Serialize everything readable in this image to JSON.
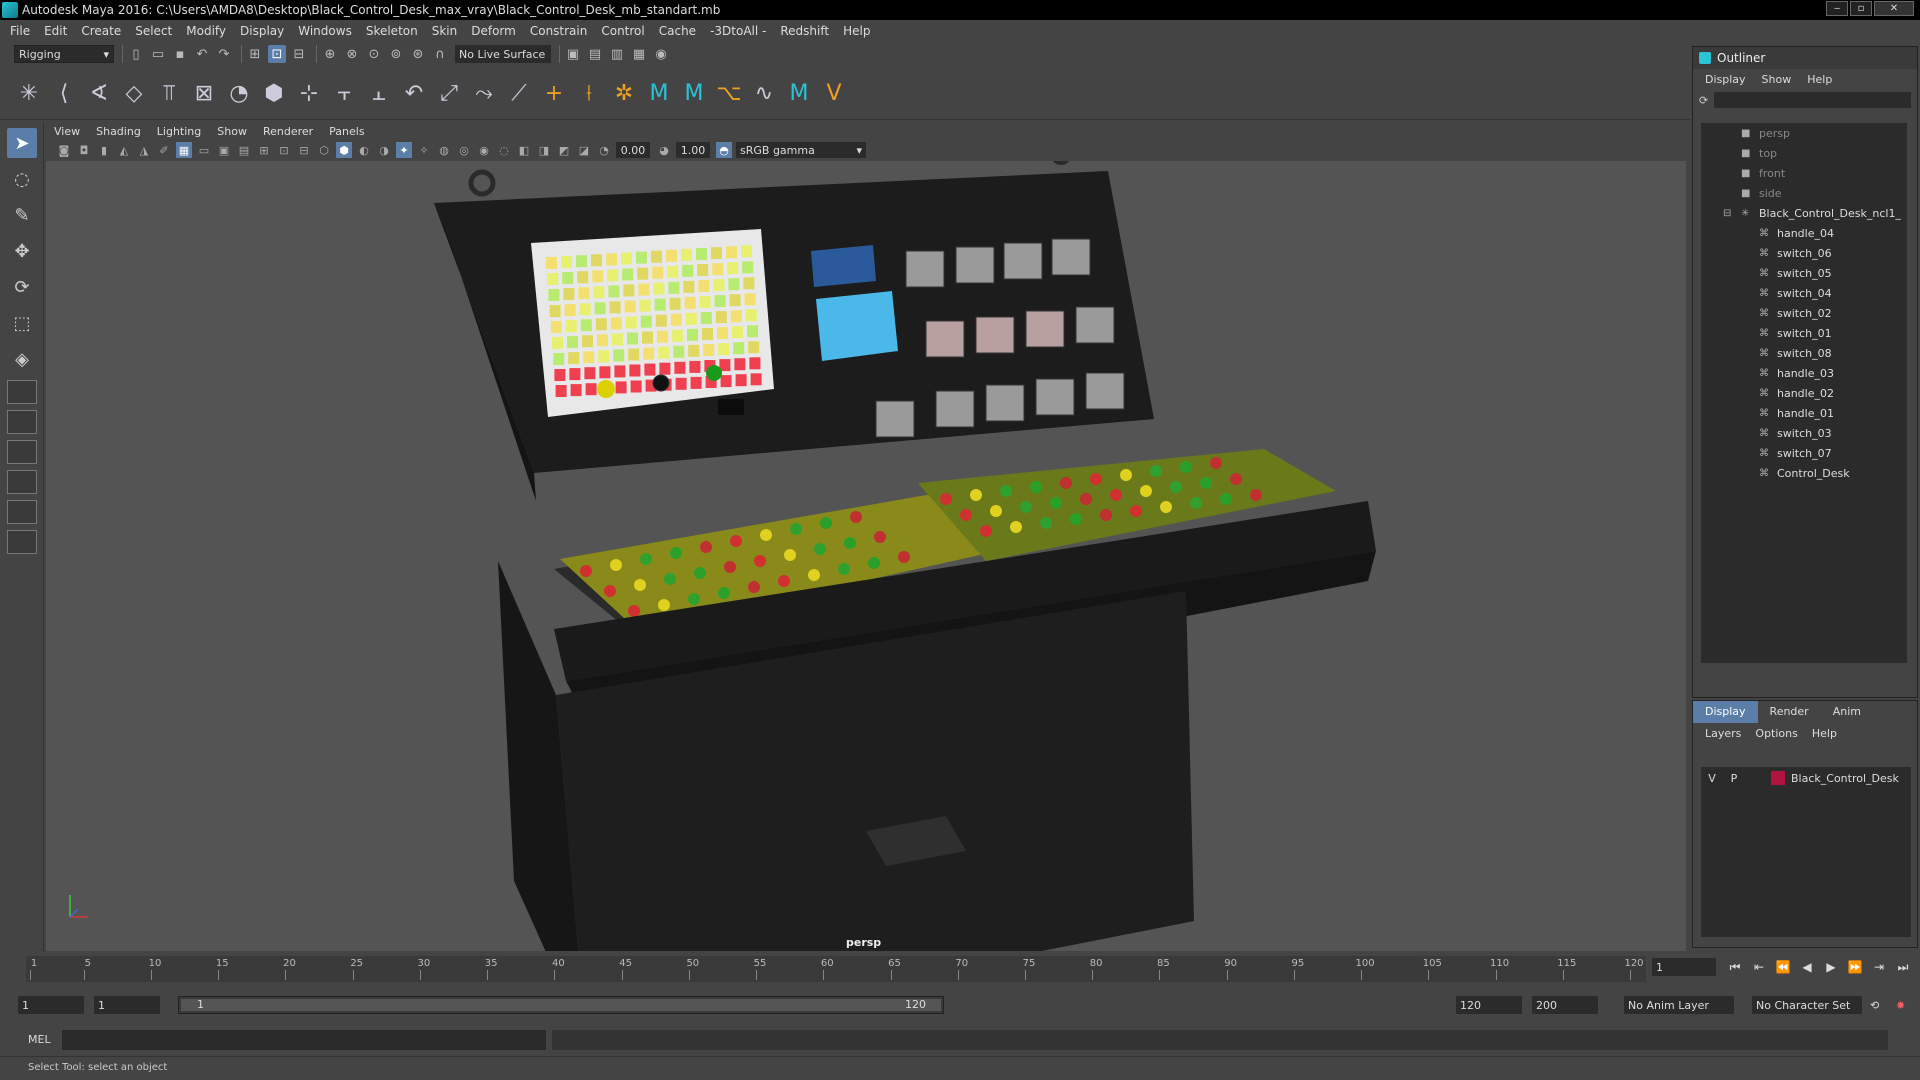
{
  "window": {
    "title": "Autodesk Maya 2016: C:\\Users\\AMDA8\\Desktop\\Black_Control_Desk_max_vray\\Black_Control_Desk_mb_standart.mb"
  },
  "menubar": [
    "File",
    "Edit",
    "Create",
    "Select",
    "Modify",
    "Display",
    "Windows",
    "Skeleton",
    "Skin",
    "Deform",
    "Constrain",
    "Control",
    "Cache",
    "-3DtoAll -",
    "Redshift",
    "Help"
  ],
  "toolbar": {
    "mode": "Rigging",
    "live_surface": "No Live Surface"
  },
  "viewport": {
    "menu": [
      "View",
      "Shading",
      "Lighting",
      "Show",
      "Renderer",
      "Panels"
    ],
    "exposure": "0.00",
    "gamma_value": "1.00",
    "color_space": "sRGB gamma",
    "camera_label": "persp"
  },
  "outliner": {
    "title": "Outliner",
    "menu": [
      "Display",
      "Show",
      "Help"
    ],
    "cameras": [
      "persp",
      "top",
      "front",
      "side"
    ],
    "root": "Black_Control_Desk_ncl1_",
    "children": [
      "handle_04",
      "switch_06",
      "switch_05",
      "switch_04",
      "switch_02",
      "switch_01",
      "switch_08",
      "handle_03",
      "handle_02",
      "handle_01",
      "switch_03",
      "switch_07",
      "Control_Desk"
    ]
  },
  "layers": {
    "tabs": [
      "Display",
      "Render",
      "Anim"
    ],
    "menu": [
      "Layers",
      "Options",
      "Help"
    ],
    "row": {
      "v": "V",
      "p": "P",
      "name": "Black_Control_Desk",
      "color": "#b01540"
    }
  },
  "timeline": {
    "ticks": [
      1,
      5,
      10,
      15,
      20,
      25,
      30,
      35,
      40,
      45,
      50,
      55,
      60,
      65,
      70,
      75,
      80,
      85,
      90,
      95,
      100,
      105,
      110,
      115,
      120
    ],
    "current_frame": "1"
  },
  "range": {
    "start": "1",
    "start2": "1",
    "slider_a": "1",
    "slider_b": "120",
    "end": "120",
    "end2": "200",
    "anim_layer": "No Anim Layer",
    "character_set": "No Character Set"
  },
  "cmdline": {
    "label": "MEL"
  },
  "helpline": {
    "text": "Select Tool: select an object"
  }
}
